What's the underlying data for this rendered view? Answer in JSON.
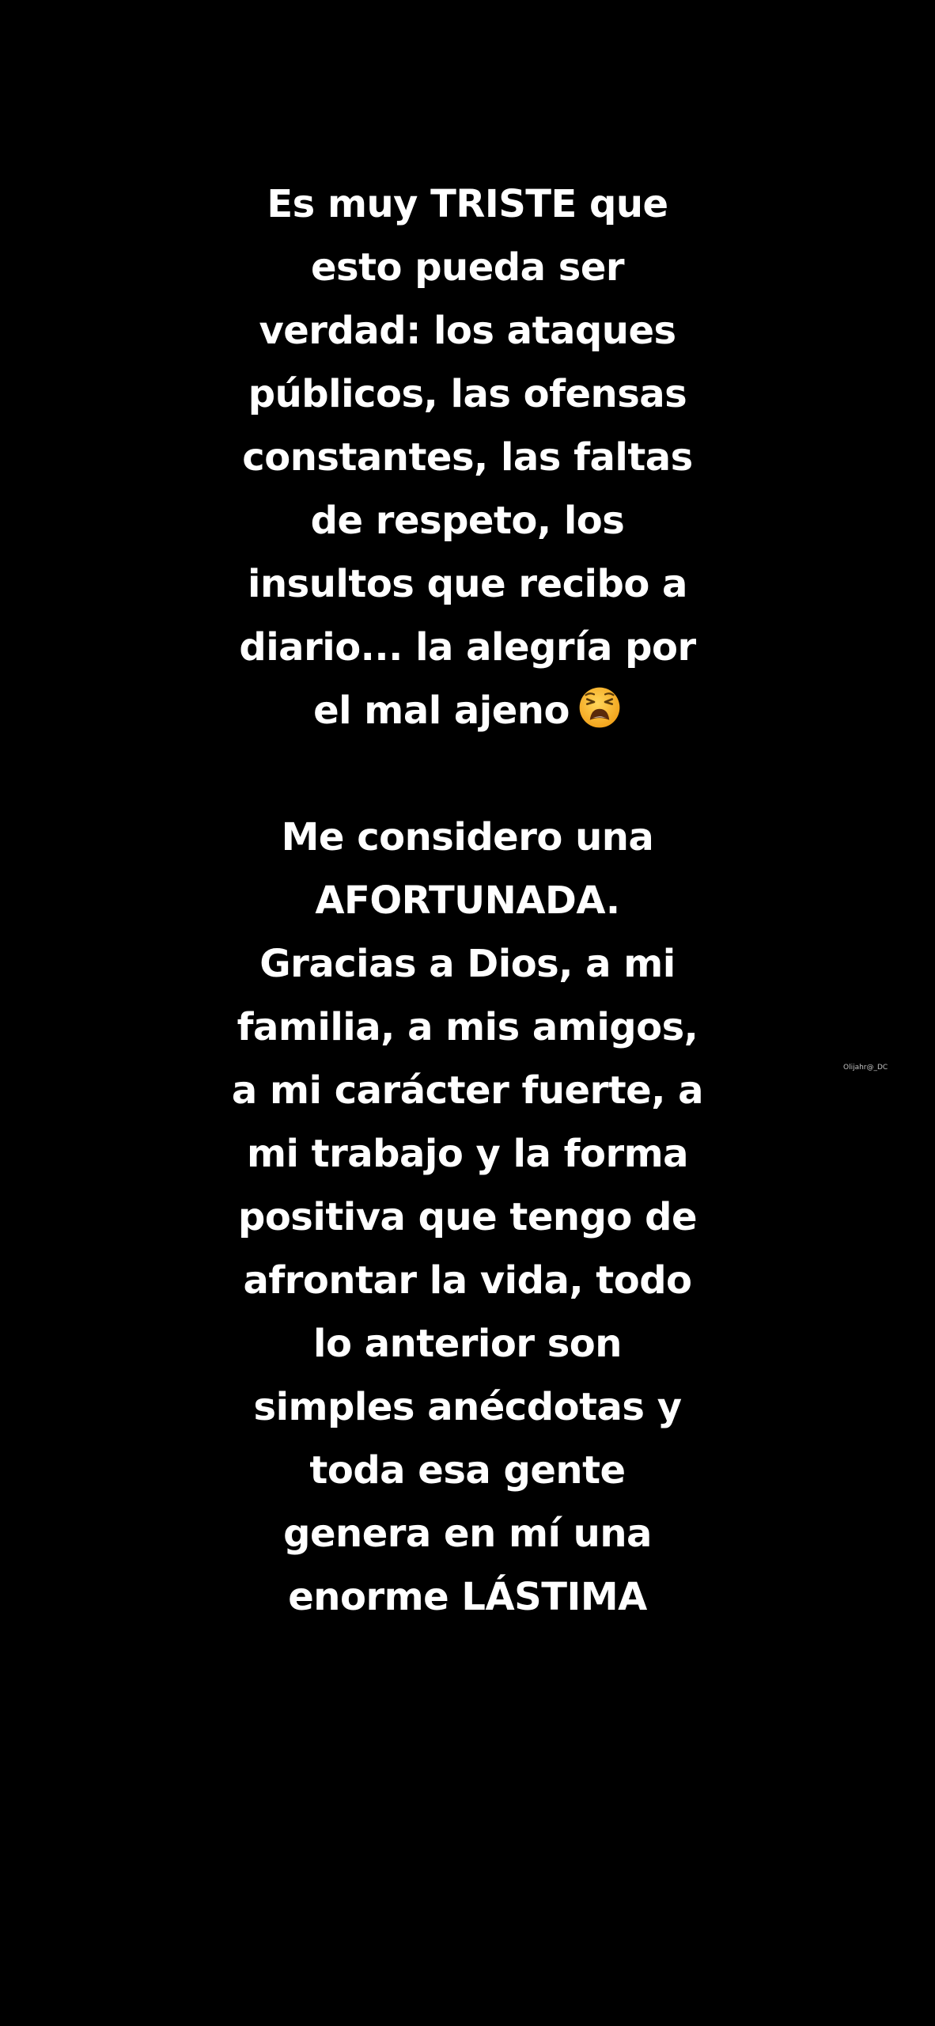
{
  "story": {
    "paragraph1": [
      "Es muy TRISTE que",
      "esto pueda ser",
      "verdad: los ataques",
      "públicos, las ofensas",
      "constantes, las faltas",
      "de respeto, los",
      "insultos que recibo a",
      "diario... la alegría por",
      "el mal ajeno"
    ],
    "emoji": "weary-face-emoji",
    "paragraph2": [
      "Me considero una",
      "AFORTUNADA.",
      "Gracias a Dios, a mi",
      "familia, a mis amigos,",
      "a mi carácter fuerte, a",
      "mi trabajo y la forma",
      "positiva que tengo de",
      "afrontar la vida, todo",
      "lo anterior son",
      "simples anécdotas y",
      "toda esa gente",
      "genera en mí una",
      "enorme LÁSTIMA"
    ],
    "watermark": "Olijahr@_DC"
  },
  "colors": {
    "background": "#000000",
    "text": "#ffffff",
    "emoji_face": "#f7b731"
  }
}
